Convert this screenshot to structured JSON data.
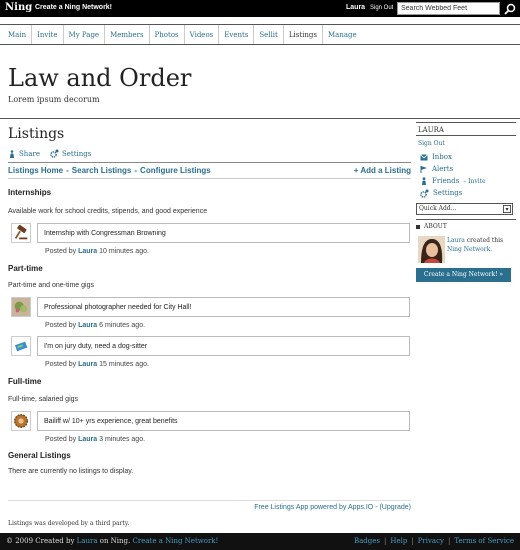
{
  "topbar": {
    "logo": "Ning",
    "create_link": "Create a Ning Network!",
    "user": "Laura",
    "signout": "Sign Out",
    "search_value": "Search Webbed Feet"
  },
  "nav": [
    "Main",
    "Invite",
    "My Page",
    "Members",
    "Photos",
    "Videos",
    "Events",
    "Sellit",
    "Listings",
    "Manage"
  ],
  "site": {
    "title": "Law and Order",
    "tagline": "Lorem ipsum decorum"
  },
  "main": {
    "title": "Listings",
    "share": "Share",
    "settings": "Settings",
    "subnav": {
      "home": "Listings Home",
      "search": "Search Listings",
      "configure": "Configure Listings",
      "add": "+ Add a Listing"
    },
    "categories": [
      {
        "name": "Internships",
        "desc": "Available work for school credits, stipends, and good experience",
        "listings": [
          {
            "title": "Internship with Congressman Browning",
            "posted_by": "Posted by",
            "author": "Laura",
            "time": "10 minutes ago.",
            "icon": "gavel-icon"
          }
        ]
      },
      {
        "name": "Part-time",
        "desc": "Part-time and one-time gigs",
        "listings": [
          {
            "title": "Professional photographer needed for City Hall!",
            "posted_by": "Posted by",
            "author": "Laura",
            "time": "6 minutes ago.",
            "icon": "photo-icon"
          },
          {
            "title": "I'm on jury duty, need a dog-sitter",
            "posted_by": "Posted by",
            "author": "Laura",
            "time": "15 minutes ago.",
            "icon": "ticket-icon"
          }
        ]
      },
      {
        "name": "Full-time",
        "desc": "Full-time, salaried gigs",
        "listings": [
          {
            "title": "Bailiff w/ 10+ yrs experience, great benefits",
            "posted_by": "Posted by",
            "author": "Laura",
            "time": "3 minutes ago.",
            "icon": "badge-icon"
          }
        ]
      },
      {
        "name": "General Listings",
        "desc": "There are currently no listings to display.",
        "listings": []
      }
    ],
    "powered": "Free Listings App powered by Apps.IO - (Upgrade)",
    "developed": "Listings was developed by a third party."
  },
  "sidebar": {
    "user": "LAURA",
    "signout": "Sign Out",
    "items": [
      {
        "label": "Inbox",
        "icon": "envelope-icon"
      },
      {
        "label": "Alerts",
        "icon": "alert-icon"
      },
      {
        "label": "Friends",
        "extra": "– Invite",
        "icon": "friends-icon"
      },
      {
        "label": "Settings",
        "icon": "gear-icon"
      }
    ],
    "quick_add": "Quick Add...",
    "about_head": "ABOUT",
    "about_user": "Laura",
    "about_created": "created this",
    "about_network": "Ning Network.",
    "create_button": "Create a Ning Network! »"
  },
  "footer": {
    "copyright": "© 2009",
    "created_by": "Created by",
    "user": "Laura",
    "on_ning": "on Ning.",
    "create_link": "Create a Ning Network!",
    "links": [
      "Badges",
      "Help",
      "Privacy",
      "Terms of Service"
    ]
  },
  "colors": {
    "link": "#2a6f8e",
    "topbar": "#000000",
    "create_button": "#2a6f8e"
  }
}
